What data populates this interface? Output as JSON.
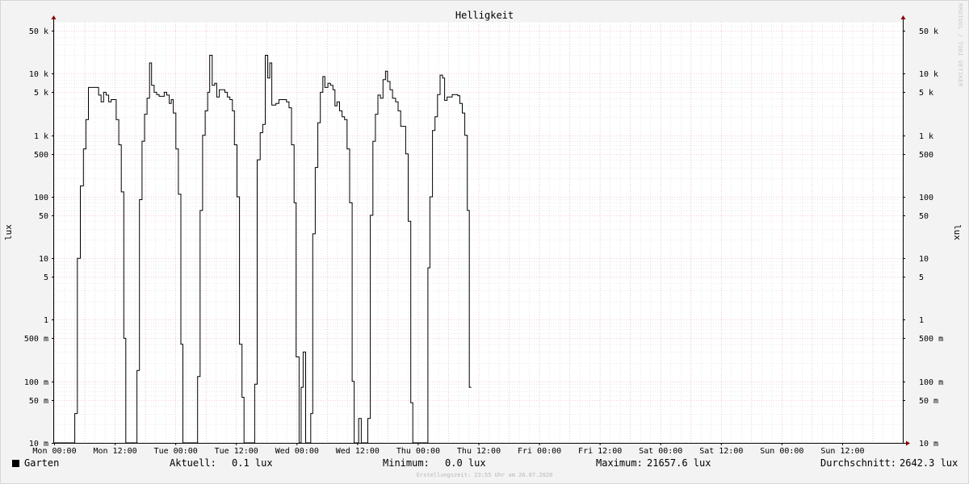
{
  "watermark": "RRDTOOL / TOBI OETIKER",
  "footer": "Erstellungszeit: 23:55 Uhr am 26.07.2020",
  "legend": {
    "series": "Garten",
    "current_label": "Aktuell:",
    "current_value": "0.1 lux",
    "min_label": "Minimum:",
    "min_value": "0.0 lux",
    "max_label": "Maximum:",
    "max_value": "21657.6 lux",
    "avg_label": "Durchschnitt:",
    "avg_value": "2642.3 lux"
  },
  "colors": {
    "line": "#000000",
    "grid_major": "#e8a0a0",
    "grid_minor": "#d8d8d8",
    "canvas": "#ffffff",
    "background": "#f3f3f3",
    "arrow": "#8b0000"
  },
  "chart_data": {
    "type": "line",
    "title": "Helligkeit",
    "ylabel": "lux",
    "y_scale": "log",
    "ylim": [
      0.01,
      70000
    ],
    "x_unit": "hours since Mon 00:00",
    "xlim": [
      0,
      168
    ],
    "x_ticks": [
      {
        "x": 0,
        "label": "Mon 00:00"
      },
      {
        "x": 12,
        "label": "Mon 12:00"
      },
      {
        "x": 24,
        "label": "Tue 00:00"
      },
      {
        "x": 36,
        "label": "Tue 12:00"
      },
      {
        "x": 48,
        "label": "Wed 00:00"
      },
      {
        "x": 60,
        "label": "Wed 12:00"
      },
      {
        "x": 72,
        "label": "Thu 00:00"
      },
      {
        "x": 84,
        "label": "Thu 12:00"
      },
      {
        "x": 96,
        "label": "Fri 00:00"
      },
      {
        "x": 108,
        "label": "Fri 12:00"
      },
      {
        "x": 120,
        "label": "Sat 00:00"
      },
      {
        "x": 132,
        "label": "Sat 12:00"
      },
      {
        "x": 144,
        "label": "Sun 00:00"
      },
      {
        "x": 156,
        "label": "Sun 12:00"
      }
    ],
    "y_ticks": [
      {
        "v": 50000,
        "label": "50 k"
      },
      {
        "v": 10000,
        "label": "10 k"
      },
      {
        "v": 5000,
        "label": "5 k"
      },
      {
        "v": 1000,
        "label": "1 k"
      },
      {
        "v": 500,
        "label": "500"
      },
      {
        "v": 100,
        "label": "100"
      },
      {
        "v": 50,
        "label": "50"
      },
      {
        "v": 10,
        "label": "10"
      },
      {
        "v": 5,
        "label": "5"
      },
      {
        "v": 1,
        "label": "1"
      },
      {
        "v": 0.5,
        "label": "500 m"
      },
      {
        "v": 0.1,
        "label": "100 m"
      },
      {
        "v": 0.05,
        "label": "50 m"
      },
      {
        "v": 0.01,
        "label": "10 m"
      }
    ],
    "series": [
      {
        "name": "Garten",
        "points": [
          [
            0,
            0.01
          ],
          [
            4.1,
            0.01
          ],
          [
            4.1,
            0.03
          ],
          [
            4.6,
            0.03
          ],
          [
            4.6,
            10
          ],
          [
            5.2,
            10
          ],
          [
            5.2,
            150
          ],
          [
            5.8,
            150
          ],
          [
            5.8,
            600
          ],
          [
            6.3,
            600
          ],
          [
            6.3,
            1800
          ],
          [
            6.8,
            1800
          ],
          [
            6.8,
            6000
          ],
          [
            8.8,
            6000
          ],
          [
            8.8,
            4500
          ],
          [
            9.3,
            4500
          ],
          [
            9.3,
            3500
          ],
          [
            9.8,
            3500
          ],
          [
            9.8,
            5000
          ],
          [
            10.3,
            5000
          ],
          [
            10.3,
            4500
          ],
          [
            10.8,
            4500
          ],
          [
            10.8,
            3500
          ],
          [
            11.3,
            3500
          ],
          [
            11.3,
            3800
          ],
          [
            12.3,
            3800
          ],
          [
            12.3,
            1800
          ],
          [
            12.8,
            1800
          ],
          [
            12.8,
            700
          ],
          [
            13.3,
            700
          ],
          [
            13.3,
            120
          ],
          [
            13.8,
            120
          ],
          [
            13.8,
            0.5
          ],
          [
            14.2,
            0.5
          ],
          [
            14.2,
            0.01
          ],
          [
            16.4,
            0.01
          ],
          [
            16.4,
            0.15
          ],
          [
            16.9,
            0.15
          ],
          [
            16.9,
            90
          ],
          [
            17.4,
            90
          ],
          [
            17.4,
            800
          ],
          [
            17.9,
            800
          ],
          [
            17.9,
            2200
          ],
          [
            18.4,
            2200
          ],
          [
            18.4,
            4000
          ],
          [
            18.9,
            4000
          ],
          [
            18.9,
            15000
          ],
          [
            19.3,
            15000
          ],
          [
            19.3,
            6500
          ],
          [
            19.8,
            6500
          ],
          [
            19.8,
            5000
          ],
          [
            20.3,
            5000
          ],
          [
            20.3,
            4600
          ],
          [
            20.8,
            4600
          ],
          [
            20.8,
            4300
          ],
          [
            21.8,
            4300
          ],
          [
            21.8,
            5000
          ],
          [
            22.3,
            5000
          ],
          [
            22.3,
            4500
          ],
          [
            22.8,
            4500
          ],
          [
            22.8,
            3300
          ],
          [
            23.2,
            3300
          ],
          [
            23.2,
            3800
          ],
          [
            23.6,
            3800
          ],
          [
            23.6,
            2300
          ],
          [
            24.1,
            2300
          ],
          [
            24.1,
            600
          ],
          [
            24.6,
            600
          ],
          [
            24.6,
            110
          ],
          [
            25.1,
            110
          ],
          [
            25.1,
            0.4
          ],
          [
            25.5,
            0.4
          ],
          [
            25.5,
            0.01
          ],
          [
            28.4,
            0.01
          ],
          [
            28.4,
            0.12
          ],
          [
            28.9,
            0.12
          ],
          [
            28.9,
            60
          ],
          [
            29.4,
            60
          ],
          [
            29.4,
            1000
          ],
          [
            29.9,
            1000
          ],
          [
            29.9,
            2500
          ],
          [
            30.4,
            2500
          ],
          [
            30.4,
            5000
          ],
          [
            30.8,
            5000
          ],
          [
            30.8,
            20000
          ],
          [
            31.3,
            20000
          ],
          [
            31.3,
            6500
          ],
          [
            31.8,
            6500
          ],
          [
            31.8,
            7000
          ],
          [
            32.2,
            7000
          ],
          [
            32.2,
            4200
          ],
          [
            32.7,
            4200
          ],
          [
            32.7,
            5500
          ],
          [
            33.8,
            5500
          ],
          [
            33.8,
            5000
          ],
          [
            34.3,
            5000
          ],
          [
            34.3,
            4200
          ],
          [
            34.8,
            4200
          ],
          [
            34.8,
            3800
          ],
          [
            35.3,
            3800
          ],
          [
            35.3,
            2500
          ],
          [
            35.7,
            2500
          ],
          [
            35.7,
            700
          ],
          [
            36.2,
            700
          ],
          [
            36.2,
            100
          ],
          [
            36.7,
            100
          ],
          [
            36.7,
            0.4
          ],
          [
            37.2,
            0.4
          ],
          [
            37.2,
            0.055
          ],
          [
            37.6,
            0.055
          ],
          [
            37.6,
            0.01
          ],
          [
            39.7,
            0.01
          ],
          [
            39.7,
            0.09
          ],
          [
            40.2,
            0.09
          ],
          [
            40.2,
            400
          ],
          [
            40.8,
            400
          ],
          [
            40.8,
            1100
          ],
          [
            41.3,
            1100
          ],
          [
            41.3,
            1500
          ],
          [
            41.8,
            1500
          ],
          [
            41.8,
            20000
          ],
          [
            42.3,
            20000
          ],
          [
            42.3,
            8500
          ],
          [
            42.7,
            8500
          ],
          [
            42.7,
            15000
          ],
          [
            43.1,
            15000
          ],
          [
            43.1,
            3100
          ],
          [
            43.9,
            3100
          ],
          [
            43.9,
            3300
          ],
          [
            44.5,
            3300
          ],
          [
            44.5,
            3800
          ],
          [
            46.0,
            3800
          ],
          [
            46.0,
            3500
          ],
          [
            46.5,
            3500
          ],
          [
            46.5,
            2800
          ],
          [
            47.0,
            2800
          ],
          [
            47.0,
            700
          ],
          [
            47.5,
            700
          ],
          [
            47.5,
            80
          ],
          [
            47.9,
            80
          ],
          [
            47.9,
            0.25
          ],
          [
            48.5,
            0.25
          ],
          [
            48.5,
            0.01
          ],
          [
            48.9,
            0.01
          ],
          [
            48.9,
            0.08
          ],
          [
            49.3,
            0.08
          ],
          [
            49.3,
            0.3
          ],
          [
            49.8,
            0.3
          ],
          [
            49.8,
            0.01
          ],
          [
            50.8,
            0.01
          ],
          [
            50.8,
            0.03
          ],
          [
            51.2,
            0.03
          ],
          [
            51.2,
            25
          ],
          [
            51.7,
            25
          ],
          [
            51.7,
            300
          ],
          [
            52.2,
            300
          ],
          [
            52.2,
            1600
          ],
          [
            52.7,
            1600
          ],
          [
            52.7,
            5000
          ],
          [
            53.2,
            5000
          ],
          [
            53.2,
            9000
          ],
          [
            53.6,
            9000
          ],
          [
            53.6,
            6000
          ],
          [
            54.2,
            6000
          ],
          [
            54.2,
            7000
          ],
          [
            54.7,
            7000
          ],
          [
            54.7,
            6500
          ],
          [
            55.2,
            6500
          ],
          [
            55.2,
            5500
          ],
          [
            55.6,
            5500
          ],
          [
            55.6,
            3000
          ],
          [
            56.0,
            3000
          ],
          [
            56.0,
            3500
          ],
          [
            56.5,
            3500
          ],
          [
            56.5,
            2500
          ],
          [
            57.0,
            2500
          ],
          [
            57.0,
            2000
          ],
          [
            57.5,
            2000
          ],
          [
            57.5,
            1800
          ],
          [
            58.0,
            1800
          ],
          [
            58.0,
            600
          ],
          [
            58.5,
            600
          ],
          [
            58.5,
            80
          ],
          [
            59.0,
            80
          ],
          [
            59.0,
            0.1
          ],
          [
            59.4,
            0.1
          ],
          [
            59.4,
            0.01
          ],
          [
            60.3,
            0.01
          ],
          [
            60.3,
            0.025
          ],
          [
            60.8,
            0.025
          ],
          [
            60.8,
            0.01
          ],
          [
            62.1,
            0.01
          ],
          [
            62.1,
            0.025
          ],
          [
            62.6,
            0.025
          ],
          [
            62.6,
            50
          ],
          [
            63.1,
            50
          ],
          [
            63.1,
            800
          ],
          [
            63.6,
            800
          ],
          [
            63.6,
            2200
          ],
          [
            64.1,
            2200
          ],
          [
            64.1,
            4500
          ],
          [
            64.6,
            4500
          ],
          [
            64.6,
            4000
          ],
          [
            65.1,
            4000
          ],
          [
            65.1,
            8000
          ],
          [
            65.6,
            8000
          ],
          [
            65.6,
            11000
          ],
          [
            66.0,
            11000
          ],
          [
            66.0,
            7500
          ],
          [
            66.5,
            7500
          ],
          [
            66.5,
            5500
          ],
          [
            67.0,
            5500
          ],
          [
            67.0,
            4000
          ],
          [
            67.6,
            4000
          ],
          [
            67.6,
            3500
          ],
          [
            68.1,
            3500
          ],
          [
            68.1,
            2500
          ],
          [
            68.6,
            2500
          ],
          [
            68.6,
            1400
          ],
          [
            69.6,
            1400
          ],
          [
            69.6,
            500
          ],
          [
            70.1,
            500
          ],
          [
            70.1,
            40
          ],
          [
            70.6,
            40
          ],
          [
            70.6,
            0.045
          ],
          [
            71.0,
            0.045
          ],
          [
            71.0,
            0.01
          ],
          [
            74.0,
            0.01
          ],
          [
            74.0,
            7
          ],
          [
            74.4,
            7
          ],
          [
            74.4,
            100
          ],
          [
            74.9,
            100
          ],
          [
            74.9,
            1200
          ],
          [
            75.4,
            1200
          ],
          [
            75.4,
            2000
          ],
          [
            75.9,
            2000
          ],
          [
            75.9,
            4600
          ],
          [
            76.4,
            4600
          ],
          [
            76.4,
            9500
          ],
          [
            76.9,
            9500
          ],
          [
            76.9,
            8500
          ],
          [
            77.3,
            8500
          ],
          [
            77.3,
            3700
          ],
          [
            77.8,
            3700
          ],
          [
            77.8,
            4200
          ],
          [
            78.8,
            4200
          ],
          [
            78.8,
            4600
          ],
          [
            79.9,
            4600
          ],
          [
            79.9,
            4400
          ],
          [
            80.3,
            4400
          ],
          [
            80.3,
            3300
          ],
          [
            80.8,
            3300
          ],
          [
            80.8,
            2300
          ],
          [
            81.3,
            2300
          ],
          [
            81.3,
            1000
          ],
          [
            81.8,
            1000
          ],
          [
            81.8,
            60
          ],
          [
            82.2,
            60
          ],
          [
            82.2,
            0.08
          ],
          [
            82.6,
            0.08
          ]
        ]
      }
    ]
  }
}
